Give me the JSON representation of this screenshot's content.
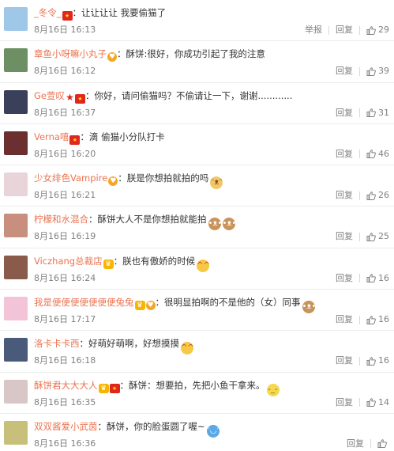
{
  "comments": [
    {
      "avatar_color": "#9fc7e8",
      "name": "_冬令_",
      "badges": [
        "flag"
      ],
      "text": "：让让让让 我要偷猫了",
      "emojis": [],
      "time": "8月16日 16:13",
      "report": "举报",
      "reply": "回复",
      "likes": "29"
    },
    {
      "avatar_color": "#6d8f63",
      "name": "章鱼小呀嘛小丸子",
      "badges": [
        "vip"
      ],
      "text": "：酥饼:很好，你成功引起了我的注意",
      "emojis": [],
      "time": "8月16日 16:12",
      "report": "",
      "reply": "回复",
      "likes": "39"
    },
    {
      "avatar_color": "#3a3f5a",
      "name": "Ge萱叹",
      "badges": [
        "star",
        "flag"
      ],
      "text": "：你好，请问偷猫吗？不偷请让一下，谢谢............",
      "emojis": [],
      "time": "8月16日 16:37",
      "report": "",
      "reply": "回复",
      "likes": "31"
    },
    {
      "avatar_color": "#6b2f2f",
      "name": "Verna嘻",
      "badges": [
        "flag"
      ],
      "text": "：滴 偷猫小分队打卡",
      "emojis": [],
      "time": "8月16日 16:20",
      "report": "",
      "reply": "回复",
      "likes": "46"
    },
    {
      "avatar_color": "#e8d4d9",
      "name": "少女绯色Vampire",
      "badges": [
        "vip"
      ],
      "text": "：朕是你想拍就拍的吗",
      "emojis": [
        "cat"
      ],
      "time": "8月16日 16:21",
      "report": "",
      "reply": "回复",
      "likes": "26"
    },
    {
      "avatar_color": "#c98f7e",
      "name": "柠檬和水混合",
      "badges": [],
      "text": "：酥饼大人不是你想拍就能拍",
      "emojis": [
        "dog",
        "dog"
      ],
      "time": "8月16日 16:19",
      "report": "",
      "reply": "回复",
      "likes": "25"
    },
    {
      "avatar_color": "#8a5a4a",
      "name": "Viczhang总裁店",
      "badges": [
        "crown"
      ],
      "text": "：朕也有傲娇的时候",
      "emojis": [
        "smile"
      ],
      "time": "8月16日 16:24",
      "report": "",
      "reply": "回复",
      "likes": "16"
    },
    {
      "avatar_color": "#f3c3d8",
      "name": "我是便便便便便便便兔兔",
      "badges": [
        "crown",
        "vip"
      ],
      "text": "：很明显拍啊的不是他的（女）同事",
      "emojis": [
        "dog"
      ],
      "time": "8月16日 17:17",
      "report": "",
      "reply": "回复",
      "likes": "16"
    },
    {
      "avatar_color": "#4a5a7a",
      "name": "洛卡卡卡西",
      "badges": [],
      "text": "：好萌好萌啊，好想摸摸",
      "emojis": [
        "smile"
      ],
      "time": "8月16日 16:18",
      "report": "",
      "reply": "回复",
      "likes": "16"
    },
    {
      "avatar_color": "#d9c7c7",
      "name": "酥饼君大大大人",
      "badges": [
        "crown",
        "flag"
      ],
      "text": "：酥饼：想要拍，先把小鱼干拿来。",
      "emojis": [
        "think"
      ],
      "time": "8月16日 16:35",
      "report": "",
      "reply": "回复",
      "likes": "14"
    },
    {
      "avatar_color": "#c8c07a",
      "name": "双双酱爱小武茵",
      "badges": [],
      "text": "：酥饼，你的脸蛋圆了喔~",
      "emojis": [
        "blue"
      ],
      "time": "8月16日 16:36",
      "report": "",
      "reply": "回复",
      "likes": ""
    }
  ]
}
